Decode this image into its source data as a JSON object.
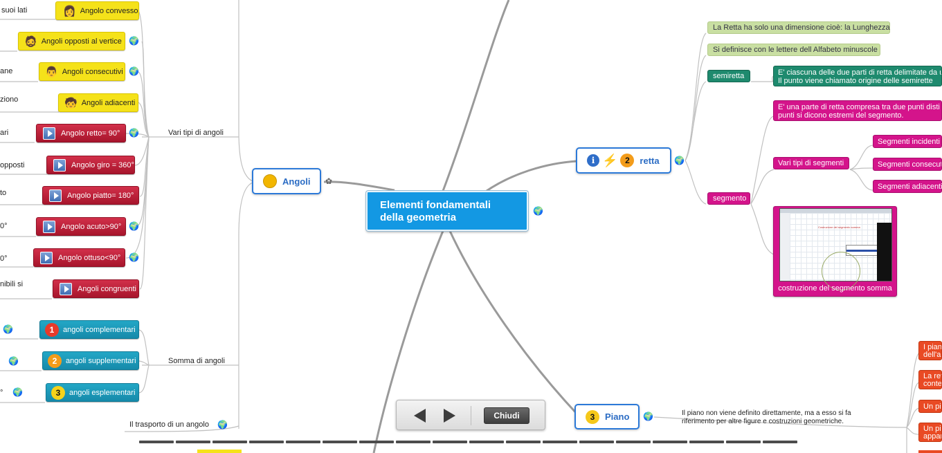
{
  "central": {
    "line1": "Elementi fondamentali",
    "line2": "della geometria"
  },
  "angoli": {
    "title": "Angoli",
    "group1_label": "Vari tipi di angoli",
    "group2_label": "Somma di angoli",
    "trasporto": "Il trasporto di un angolo",
    "left_fragments": [
      "suoi lati",
      "ane",
      "ziono",
      "ari",
      "opposti",
      "to",
      "0°",
      "0°",
      "nibili si",
      "°"
    ],
    "nodes": [
      "Angolo convesso",
      "Angoli opposti al vertice",
      "Angoli consecutivi",
      "Angoli adiacenti",
      "Angolo retto= 90°",
      "Angolo giro = 360°",
      "Angolo piatto= 180°",
      "Angolo acuto>90°",
      "Angolo ottuso<90°",
      "Angoli congruenti"
    ],
    "somma": [
      "angoli complementari",
      "angoli supplementari",
      "angoli esplementari"
    ],
    "somma_numbers": [
      "1",
      "2",
      "3"
    ]
  },
  "retta": {
    "title": "retta",
    "badge": "2",
    "defs": [
      "La Retta ha solo una dimensione cioè: la Lunghezza",
      "Si definisce con le lettere dell Alfabeto minuscole"
    ],
    "semiretta": "semiretta",
    "semiretta_desc": [
      "E' ciascuna delle due parti di retta delimitate da u",
      "Il punto viene chiamato origine delle semirette"
    ],
    "segmento": "segmento",
    "segmento_desc": [
      "E' una parte di retta  compresa tra due punti disti",
      "punti si dicono estremi del segmento."
    ],
    "vari_segmenti": "Vari tipi di segmenti",
    "seg_types": [
      "Segmenti incidenti",
      "Segmenti consecuti",
      "Segmenti adiacenti"
    ],
    "image_caption": "costruzione del segmento somma",
    "image_title": "Costruzione del segmento somma"
  },
  "piano": {
    "title": "Piano",
    "badge": "3",
    "desc": [
      "Il piano non viene definito direttamente, ma a esso si fa",
      "riferimento per altre figure e costruzioni geometriche."
    ],
    "right_nodes": [
      [
        "I pian",
        "dell'al"
      ],
      [
        "La ret",
        "conte"
      ],
      [
        "Un pia"
      ],
      [
        "Un pia",
        "appar"
      ]
    ]
  },
  "nav": {
    "close_label": "Chiudi"
  },
  "colors": {
    "accent_blue": "#1398e3",
    "red_node": "#b81d36",
    "teal_node": "#1b97b8",
    "yellow_node": "#f5e21a",
    "pink_node": "#d4148b"
  }
}
